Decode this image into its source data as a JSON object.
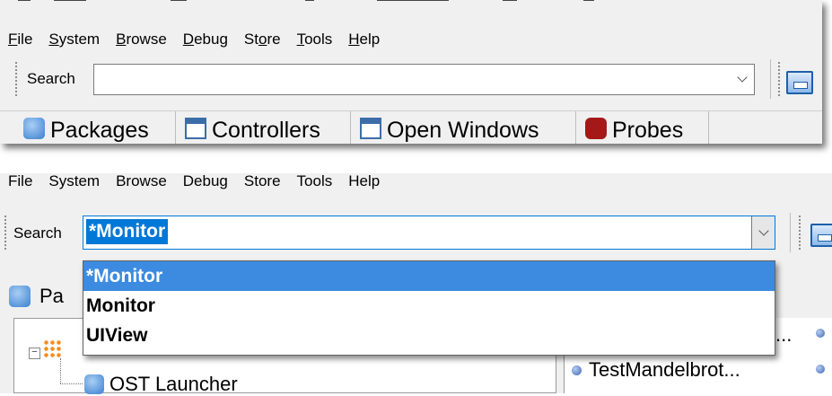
{
  "menu": [
    {
      "label": "File",
      "mnemonic": "F"
    },
    {
      "label": "System",
      "mnemonic": "S"
    },
    {
      "label": "Browse",
      "mnemonic": "B"
    },
    {
      "label": "Debug",
      "mnemonic": "D"
    },
    {
      "label": "Store",
      "mnemonic": "o"
    },
    {
      "label": "Tools",
      "mnemonic": "T"
    },
    {
      "label": "Help",
      "mnemonic": "H"
    }
  ],
  "search": {
    "label": "Search",
    "value_before": "",
    "value_after": "*Monitor"
  },
  "tabs": [
    {
      "label": "Packages",
      "icon": "package-icon"
    },
    {
      "label": "Controllers",
      "icon": "window-icon"
    },
    {
      "label": "Open Windows",
      "icon": "window-icon"
    },
    {
      "label": "Probes",
      "icon": "probe-icon"
    }
  ],
  "dropdown": {
    "options": [
      "*Monitor",
      "Monitor",
      "UIView"
    ],
    "highlighted_index": 0
  },
  "lower": {
    "partial_tab_label": "Pa",
    "tree_item": "OST Launcher",
    "right_item": "TestMandelbrot...",
    "right_item_top": "..."
  },
  "colors": {
    "selection": "#0078d7",
    "dropdown_highlight": "#3c8be0",
    "window_bg": "#f0f0f0"
  }
}
